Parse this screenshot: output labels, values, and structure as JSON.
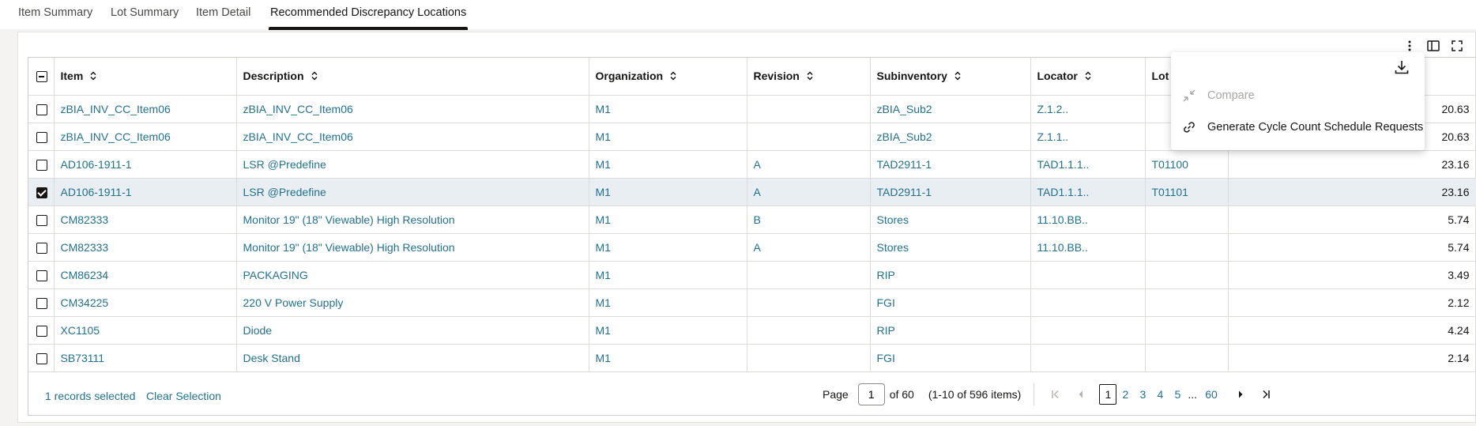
{
  "tabs": [
    {
      "label": "Item Summary"
    },
    {
      "label": "Lot Summary"
    },
    {
      "label": "Item Detail"
    },
    {
      "label": "Recommended Discrepancy Locations"
    }
  ],
  "active_tab": "Recommended Discrepancy Locations",
  "columns": {
    "item": "Item",
    "description": "Description",
    "organization": "Organization",
    "revision": "Revision",
    "subinventory": "Subinventory",
    "locator": "Locator",
    "lot": "Lot"
  },
  "rows": [
    {
      "selected": false,
      "item": "zBIA_INV_CC_Item06",
      "description": "zBIA_INV_CC_Item06",
      "organization": "M1",
      "revision": "",
      "subinventory": "zBIA_Sub2",
      "locator": "Z.1.2..",
      "lot": "",
      "value": "20.63"
    },
    {
      "selected": false,
      "item": "zBIA_INV_CC_Item06",
      "description": "zBIA_INV_CC_Item06",
      "organization": "M1",
      "revision": "",
      "subinventory": "zBIA_Sub2",
      "locator": "Z.1.1..",
      "lot": "",
      "value": "20.63"
    },
    {
      "selected": false,
      "item": "AD106-1911-1",
      "description": "LSR @Predefine",
      "organization": "M1",
      "revision": "A",
      "subinventory": "TAD2911-1",
      "locator": "TAD1.1.1..",
      "lot": "T01100",
      "value": "23.16"
    },
    {
      "selected": true,
      "item": "AD106-1911-1",
      "description": "LSR @Predefine",
      "organization": "M1",
      "revision": "A",
      "subinventory": "TAD2911-1",
      "locator": "TAD1.1.1..",
      "lot": "T01101",
      "value": "23.16"
    },
    {
      "selected": false,
      "item": "CM82333",
      "description": "Monitor 19\" (18\" Viewable) High Resolution",
      "organization": "M1",
      "revision": "B",
      "subinventory": "Stores",
      "locator": "11.10.BB..",
      "lot": "",
      "value": "5.74"
    },
    {
      "selected": false,
      "item": "CM82333",
      "description": "Monitor 19\" (18\" Viewable) High Resolution",
      "organization": "M1",
      "revision": "A",
      "subinventory": "Stores",
      "locator": "11.10.BB..",
      "lot": "",
      "value": "5.74"
    },
    {
      "selected": false,
      "item": "CM86234",
      "description": "PACKAGING",
      "organization": "M1",
      "revision": "",
      "subinventory": "RIP",
      "locator": "",
      "lot": "",
      "value": "3.49"
    },
    {
      "selected": false,
      "item": "CM34225",
      "description": "220 V Power Supply",
      "organization": "M1",
      "revision": "",
      "subinventory": "FGI",
      "locator": "",
      "lot": "",
      "value": "2.12"
    },
    {
      "selected": false,
      "item": "XC1105",
      "description": "Diode",
      "organization": "M1",
      "revision": "",
      "subinventory": "RIP",
      "locator": "",
      "lot": "",
      "value": "4.24"
    },
    {
      "selected": false,
      "item": "SB73111",
      "description": "Desk Stand",
      "organization": "M1",
      "revision": "",
      "subinventory": "FGI",
      "locator": "",
      "lot": "",
      "value": "2.14"
    }
  ],
  "footer": {
    "records_selected": "1 records selected",
    "clear_selection": "Clear Selection"
  },
  "pagination": {
    "page_label": "Page",
    "current_page": "1",
    "of_label": "of 60",
    "range_label": "(1-10 of 596 items)",
    "pages": [
      "1",
      "2",
      "3",
      "4",
      "5"
    ],
    "ellipsis": "...",
    "last_page": "60"
  },
  "menu": {
    "compare": "Compare",
    "generate": "Generate Cycle Count Schedule Requests"
  },
  "colors": {
    "link": "#227191",
    "selected_row": "#e9eef2",
    "text": "#161513"
  }
}
